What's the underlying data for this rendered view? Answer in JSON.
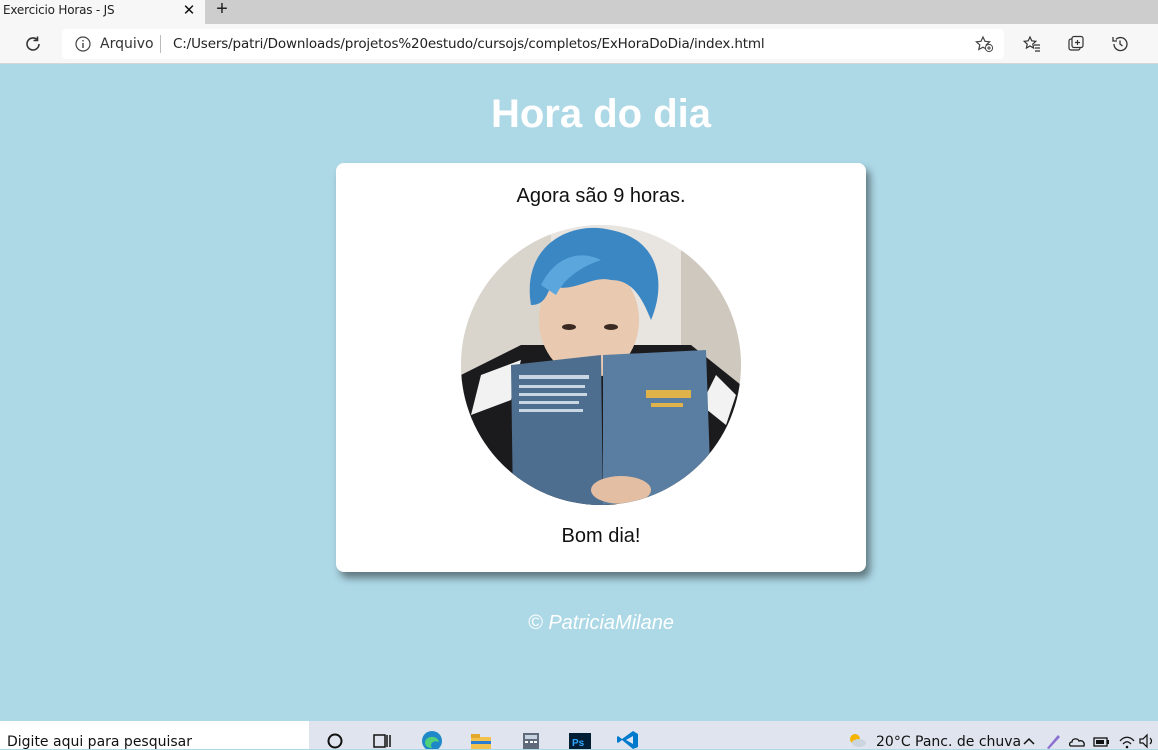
{
  "browser": {
    "tab_title": "Exercicio Horas - JS",
    "tab_close_glyph": "✕",
    "new_tab_glyph": "+",
    "scheme_label": "Arquivo",
    "url": "C:/Users/patri/Downloads/projetos%20estudo/cursojs/completos/ExHoraDoDia/index.html",
    "icons": [
      "refresh-icon",
      "info-icon",
      "add-favorite-icon",
      "favorites-icon",
      "collections-icon",
      "history-icon"
    ]
  },
  "page": {
    "title": "Hora do dia",
    "time_message": "Agora são 9 horas.",
    "greeting": "Bom dia!",
    "footer": "© PatriciaMilane",
    "background_color": "#add8e6",
    "card_color": "#ffffff"
  },
  "taskbar": {
    "search_placeholder": "Digite aqui para pesquisar",
    "weather_temp": "20°C",
    "weather_condition": "Panc. de chuva",
    "apps": [
      "cortana-icon",
      "task-view-icon",
      "edge-icon",
      "file-explorer-icon",
      "calculator-icon",
      "photoshop-icon",
      "vscode-icon"
    ]
  }
}
